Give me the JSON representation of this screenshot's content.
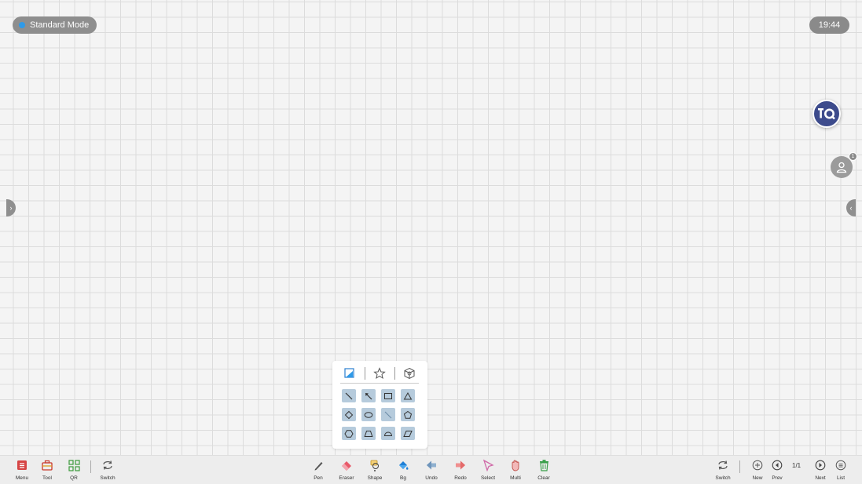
{
  "header": {
    "mode_label": "Standard Mode",
    "clock": "19:44"
  },
  "side": {
    "user_badge_count": "1"
  },
  "shape_panel": {
    "tabs": [
      "shape-2d-icon",
      "star-icon",
      "3d-cube-icon"
    ],
    "shapes": [
      "line-icon",
      "arrow-icon",
      "rectangle-icon",
      "triangle-icon",
      "diamond-icon",
      "ellipse-icon",
      "diagonal-line-icon",
      "pentagon-icon",
      "hexagon-icon",
      "trapezoid-icon",
      "semicircle-icon",
      "parallelogram-icon"
    ]
  },
  "toolbar": {
    "left": [
      {
        "label": "Menu",
        "icon": "menu-icon"
      },
      {
        "label": "Tool",
        "icon": "toolbox-icon"
      },
      {
        "label": "QR",
        "icon": "qr-icon"
      },
      {
        "label": "Switch",
        "icon": "switch-icon"
      }
    ],
    "center": [
      {
        "label": "Pen",
        "icon": "pen-icon"
      },
      {
        "label": "Eraser",
        "icon": "eraser-icon"
      },
      {
        "label": "Shape",
        "icon": "shape-icon"
      },
      {
        "label": "Bg",
        "icon": "paint-bucket-icon"
      },
      {
        "label": "Undo",
        "icon": "undo-icon"
      },
      {
        "label": "Redo",
        "icon": "redo-icon"
      },
      {
        "label": "Select",
        "icon": "select-icon"
      },
      {
        "label": "Multi",
        "icon": "hand-icon"
      },
      {
        "label": "Clear",
        "icon": "trash-icon"
      }
    ],
    "right": [
      {
        "label": "Switch",
        "icon": "switch-icon"
      },
      {
        "label": "New",
        "icon": "plus-icon"
      },
      {
        "label": "Prev",
        "icon": "prev-icon"
      },
      {
        "label": "Next",
        "icon": "next-icon"
      },
      {
        "label": "List",
        "icon": "list-icon"
      }
    ],
    "page_indicator": "1/1"
  },
  "colors": {
    "accent_blue": "#2f9ae8",
    "iq_button": "#3d4b8c",
    "shape_cell": "#b6cbdc"
  }
}
